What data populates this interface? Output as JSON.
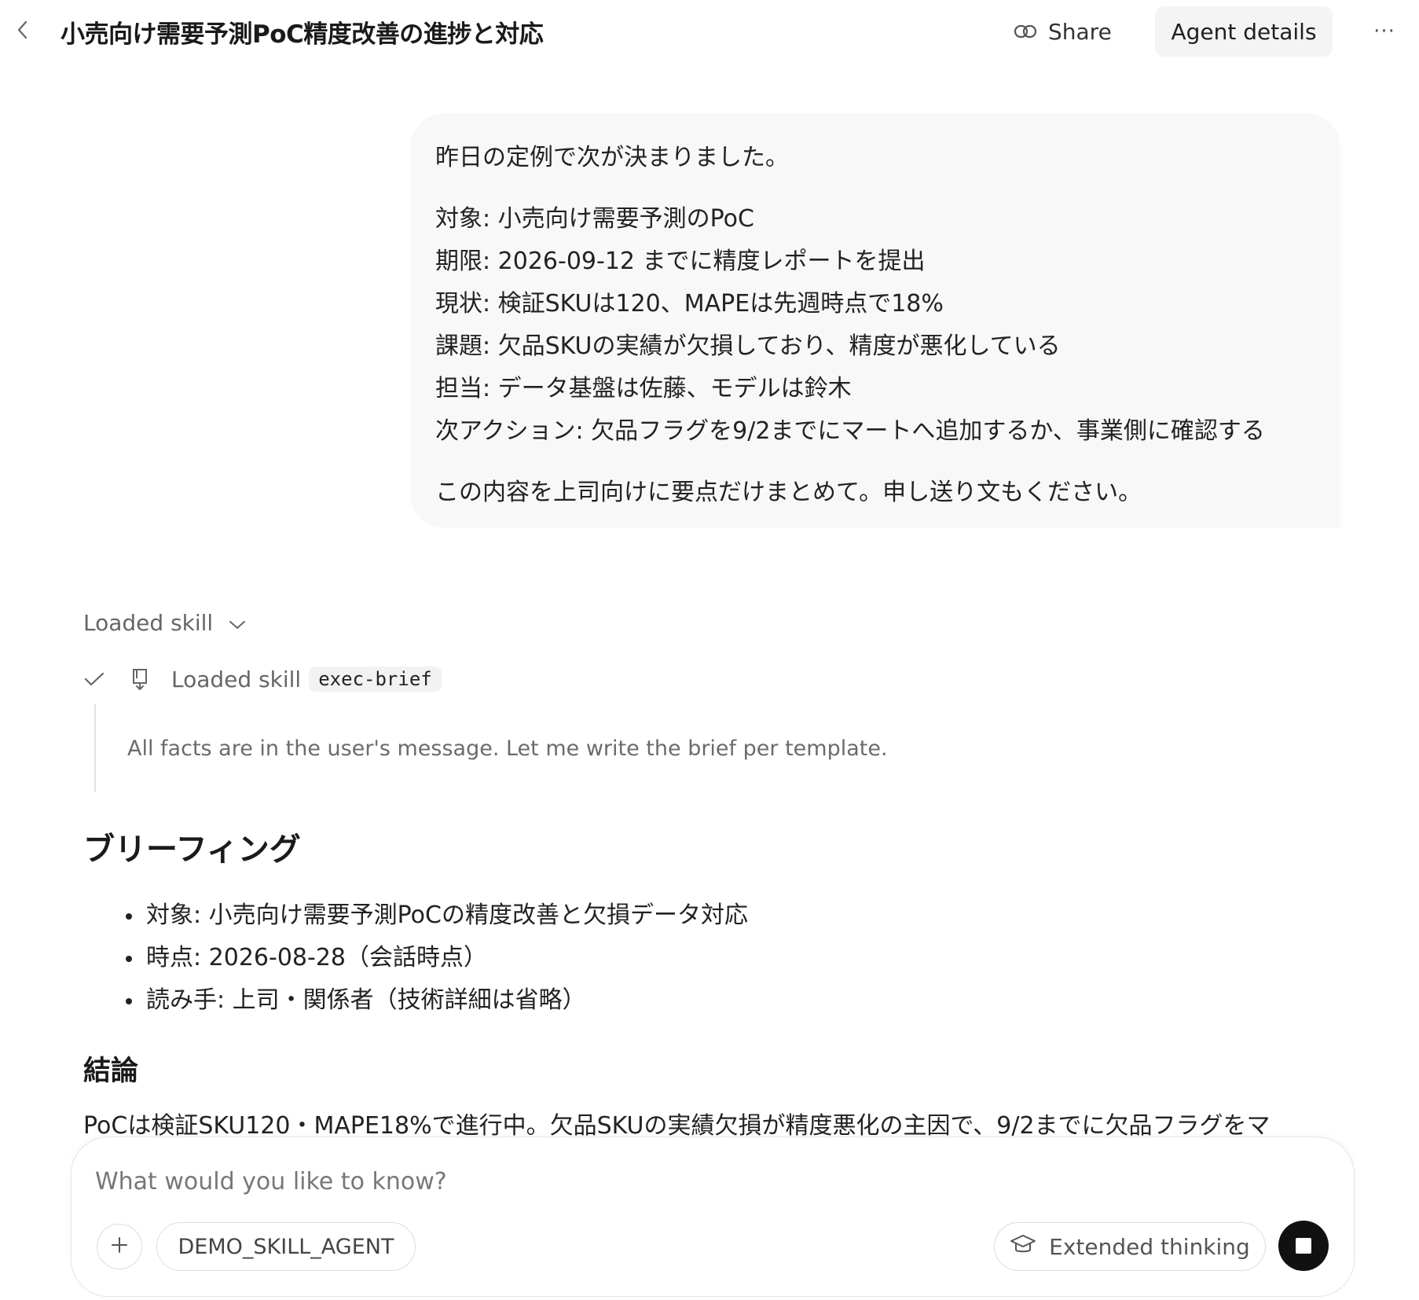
{
  "header": {
    "title": "小売向け需要予測PoC精度改善の進捗と対応",
    "share_label": "Share",
    "agent_details_label": "Agent details",
    "more_label": "···"
  },
  "user_message": {
    "lines": [
      "昨日の定例で次が決まりました。",
      "対象: 小売向け需要予測のPoC",
      "期限: 2026-09-12 までに精度レポートを提出",
      "現状: 検証SKUは120、MAPEは先週時点で18%",
      "課題: 欠品SKUの実績が欠損しており、精度が悪化している",
      "担当: データ基盤は佐藤、モデルは鈴木",
      "次アクション: 欠品フラグを9/2までにマートへ追加するか、事業側に確認する",
      "この内容を上司向けに要点だけまとめて。申し送り文もください。"
    ]
  },
  "skill": {
    "toggle_label": "Loaded skill",
    "row_label": "Loaded skill",
    "skill_name": "exec-brief",
    "thinking_text": "All facts are in the user's message. Let me write the brief per template."
  },
  "response": {
    "heading": "ブリーフィング",
    "bullets": [
      "対象: 小売向け需要予測PoCの精度改善と欠損データ対応",
      "時点: 2026-08-28（会話時点）",
      "読み手: 上司・関係者（技術詳細は省略）"
    ],
    "conclusion_heading": "結論",
    "conclusion_text": "PoCは検証SKU120・MAPE18%で進行中。欠品SKUの実績欠損が精度悪化の主因で、9/2までに欠品フラグをマ"
  },
  "composer": {
    "placeholder": "What would you like to know?",
    "agent_chip": "DEMO_SKILL_AGENT",
    "extended_thinking_label": "Extended thinking"
  },
  "icons": {
    "back": "chevron-left-icon",
    "share": "link-icon",
    "check": "check-icon",
    "skill": "book-icon",
    "chevron": "chevron-down-icon",
    "plus": "plus-icon",
    "thinking": "graduation-cap-icon",
    "stop": "stop-icon"
  }
}
